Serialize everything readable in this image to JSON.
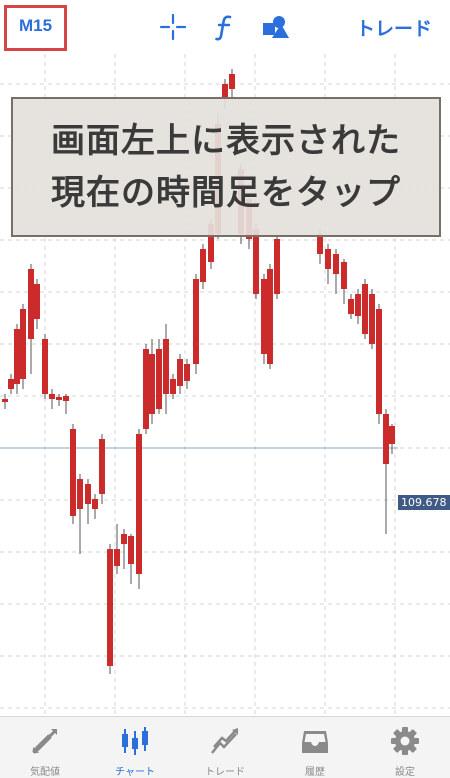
{
  "toolbar": {
    "timeframe": "M15",
    "icons": [
      "crosshair-icon",
      "function-icon",
      "objects-icon"
    ],
    "trade_label": "トレード"
  },
  "chart_data": {
    "type": "candlestick",
    "current_price": "109.678",
    "colors": {
      "up": "#3daa3d",
      "down": "#cc2b2b",
      "price_line": "#8fa3c4",
      "price_tag": "#3f5a84",
      "grid": "#d6d6d6"
    },
    "grid": true
  },
  "overlay": {
    "line1": "画面左上に表示された",
    "line2": "現在の時間足をタップ"
  },
  "nav": {
    "items": [
      {
        "label": "気配値",
        "icon": "quotes-icon",
        "active": false
      },
      {
        "label": "チャート",
        "icon": "chart-icon",
        "active": true
      },
      {
        "label": "トレード",
        "icon": "trade-icon",
        "active": false
      },
      {
        "label": "履歴",
        "icon": "history-icon",
        "active": false
      },
      {
        "label": "設定",
        "icon": "settings-icon",
        "active": false
      }
    ]
  },
  "colors": {
    "accent": "#2a6fdb",
    "highlight_box": "#d64545",
    "nav_inactive": "#8a8a8a"
  }
}
